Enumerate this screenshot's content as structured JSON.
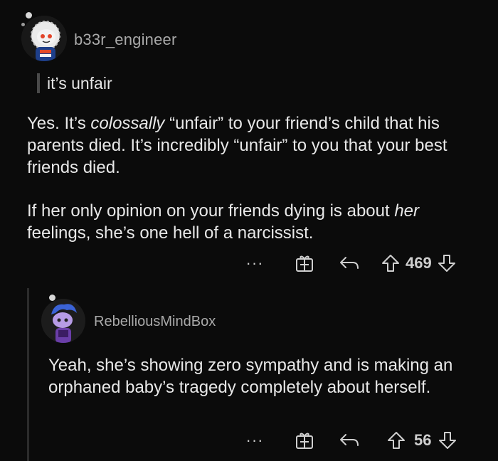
{
  "comment": {
    "username": "b33r_engineer",
    "quote": "it’s unfair",
    "paragraph1": [
      {
        "text": "Yes. It’s ",
        "italic": false
      },
      {
        "text": "colossally",
        "italic": true
      },
      {
        "text": " “unfair” to your friend’s child that his parents died. It’s incredibly “unfair” to you that your best friends died.",
        "italic": false
      }
    ],
    "paragraph2": [
      {
        "text": "If her only opinion on your friends dying is about ",
        "italic": false
      },
      {
        "text": "her",
        "italic": true
      },
      {
        "text": " feelings, she’s one hell of a narcissist.",
        "italic": false
      }
    ],
    "more_label": "···",
    "upvotes": "469"
  },
  "reply": {
    "username": "RebelliousMindBox",
    "text": "Yeah, she’s showing zero sympathy and is making an orphaned baby’s tragedy completely about herself.",
    "more_label": "···",
    "upvotes": "56"
  },
  "icons": [
    "more-options-icon",
    "award-gift-icon",
    "reply-arrow-icon",
    "upvote-arrow-icon",
    "downvote-arrow-icon"
  ]
}
